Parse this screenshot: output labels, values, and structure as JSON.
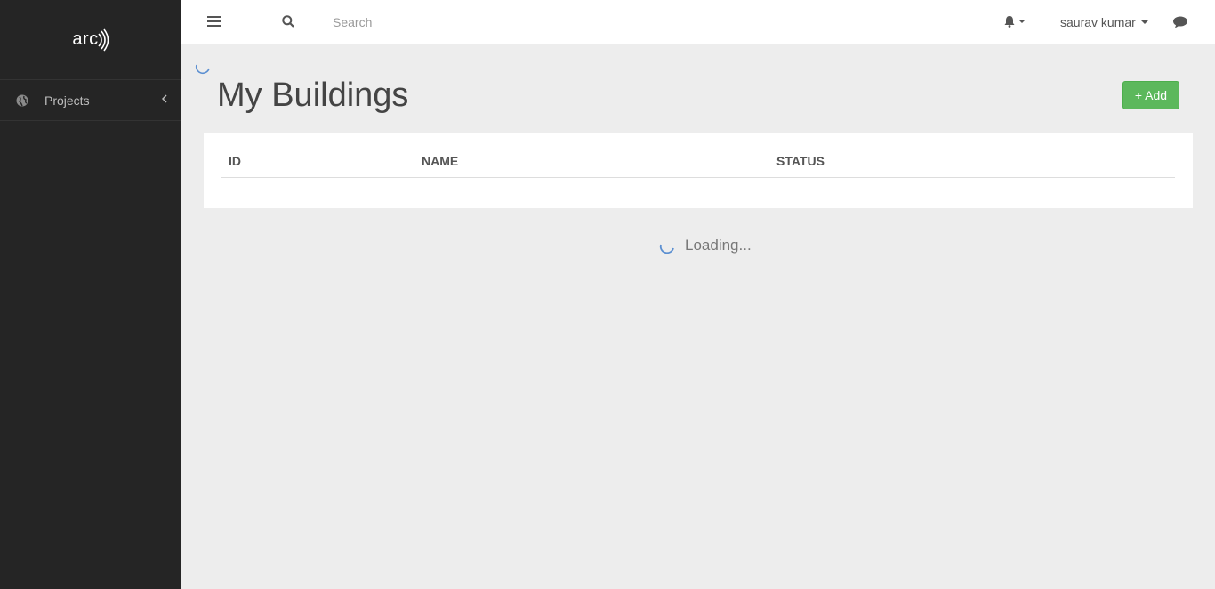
{
  "sidebar": {
    "logo_text": "arc",
    "items": [
      {
        "label": "Projects",
        "icon": "globe-icon"
      }
    ]
  },
  "topbar": {
    "search_placeholder": "Search",
    "user_name": "saurav kumar"
  },
  "main": {
    "title": "My Buildings",
    "add_label": "+ Add",
    "table": {
      "columns": [
        "ID",
        "NAME",
        "STATUS"
      ],
      "rows": []
    },
    "loading_text": "Loading..."
  },
  "colors": {
    "sidebar_bg": "#252525",
    "page_bg": "#ededed",
    "add_button": "#5cb85c",
    "spinner": "#5b8fd1"
  }
}
